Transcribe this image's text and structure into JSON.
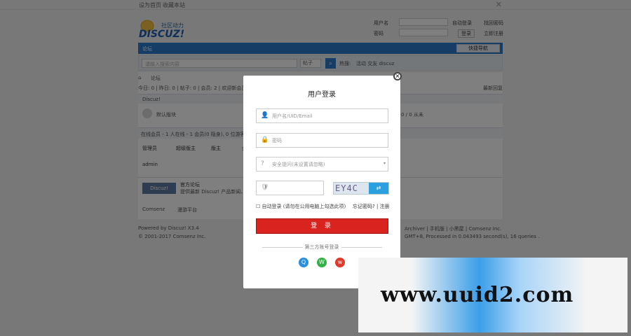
{
  "topbar": {
    "links": [
      "设为首页",
      "收藏本站"
    ]
  },
  "logo": {
    "tagline": "社区动力",
    "brand": "DISCUZ!"
  },
  "header_login": {
    "user_label": "用户名",
    "pass_label": "密码",
    "auto_login": "自动登录",
    "find_pass": "找回密码",
    "login_btn": "登录",
    "register": "立即注册"
  },
  "nav": {
    "home": "论坛",
    "quick": "快捷导航"
  },
  "search": {
    "placeholder": "请输入搜索内容",
    "type": "帖子",
    "hot_label": "热搜:",
    "hot": "活动 交友 discuz"
  },
  "breadcrumb": "论坛",
  "stats": "今日: 0 | 昨日: 0 | 帖子: 0 | 会员: 2 | 欢迎新会员: admin",
  "new_posts": "最新回复",
  "forum_section": "Discuz!",
  "forum_name": "默认版块",
  "forum_stats": "0 / 0  从未",
  "online": {
    "title": "在线会员 - 1 人在线 - 1 会员(0 隐身), 0 位游客",
    "legend": [
      "管理员",
      "超级版主",
      "版主",
      "会员"
    ],
    "user": "admin"
  },
  "partner": {
    "name": "Discuz!",
    "label": "官方论坛",
    "desc": "提供最新 Discuz! 产品新闻、软件下载与技术交流"
  },
  "links_row": [
    "Comsenz",
    "漫游平台"
  ],
  "footer": {
    "powered": "Powered by Discuz! X3.4",
    "copyright": "© 2001-2017 Comsenz Inc.",
    "right_links": "Archiver | 手机版 | 小黑屋 | Comsenz Inc.",
    "gmt": "GMT+8, Processed in 0.043493 second(s), 16 queries ."
  },
  "modal": {
    "title": "用户登录",
    "username_placeholder": "用户名/UID/Email",
    "password_placeholder": "密码",
    "question_placeholder": "安全提问(未设置请忽略)",
    "captcha_placeholder": "",
    "captcha_code": "EY4C",
    "remember": "自动登录 (请勿在公用电脑上勾选此项)",
    "forgot": "忘记密码? | 注册",
    "login_button": "登 录",
    "quick_login": "第三方账号登录"
  },
  "watermark": "www.uuid2.com",
  "colors": {
    "accent": "#2b7acd",
    "login_red": "#d9231f",
    "qq": "#2a8fe0",
    "wechat": "#34b146",
    "weibo": "#e03a2c"
  }
}
